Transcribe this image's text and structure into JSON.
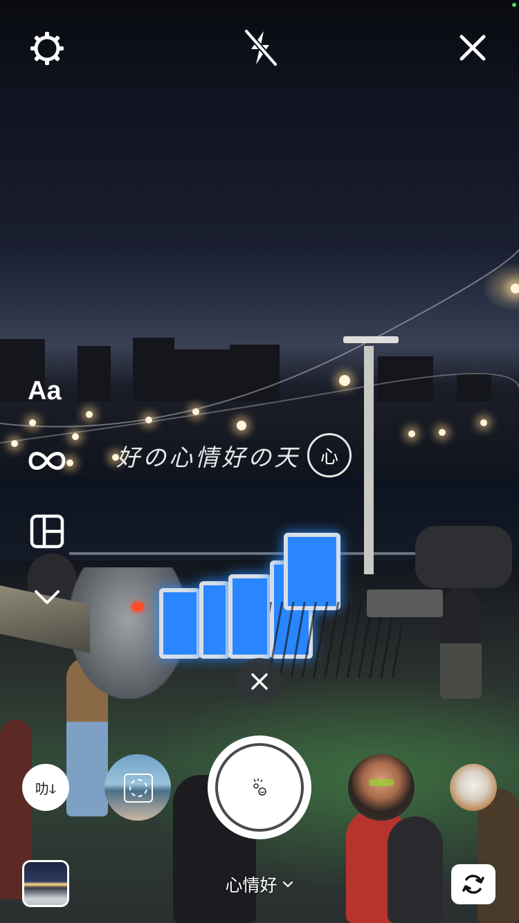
{
  "top_bar": {
    "settings_icon": "gear-icon",
    "flash_icon": "flash-off-icon",
    "close_icon": "close-icon"
  },
  "side_tools": {
    "text_label": "Aa",
    "boomerang_icon": "infinity-icon",
    "layout_icon": "layout-grid-icon",
    "more_icon": "chevron-down-icon"
  },
  "overlay": {
    "handwriting_text": "好の心情好の天",
    "smiley_text": "心"
  },
  "filters": {
    "selected_name": "心情好",
    "chevron": "⌄",
    "items": [
      "text-filter",
      "scenic-filter",
      "selected-filter",
      "portrait-filter",
      "cat-filter"
    ],
    "first_item_text": "叻ↆ"
  },
  "bottom": {
    "gallery_icon": "gallery-thumbnail-icon",
    "switch_camera_icon": "camera-switch-icon"
  },
  "colors": {
    "accent": "#ffffff",
    "status_dot": "#4cd964",
    "sign_blue": "#2a86ff"
  }
}
